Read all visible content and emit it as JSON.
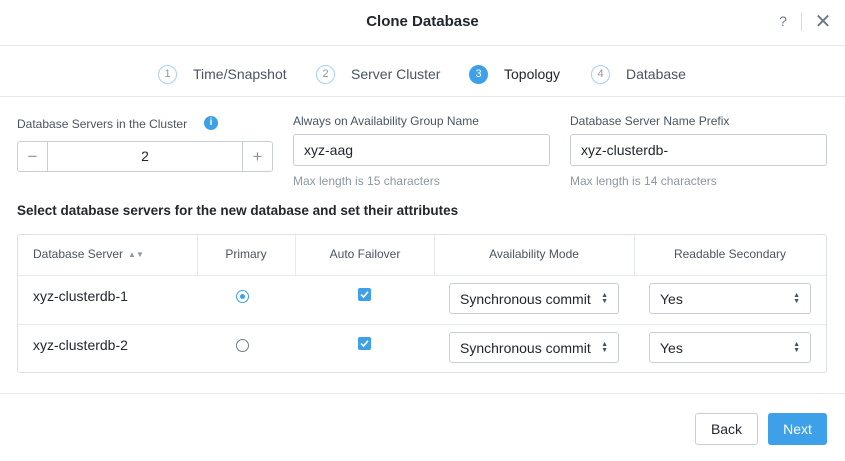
{
  "dialog": {
    "title": "Clone Database",
    "help_label": "?",
    "close_label": "✕"
  },
  "steps": [
    {
      "number": "1",
      "label": "Time/Snapshot",
      "active": false
    },
    {
      "number": "2",
      "label": "Server Cluster",
      "active": false
    },
    {
      "number": "3",
      "label": "Topology",
      "active": true
    },
    {
      "number": "4",
      "label": "Database",
      "active": false
    }
  ],
  "form": {
    "servers_count": {
      "label": "Database Servers in the Cluster",
      "info_icon": "i",
      "value": "2",
      "minus": "−",
      "plus": "+"
    },
    "ag_name": {
      "label": "Always on Availability Group Name",
      "value": "xyz-aag",
      "hint": "Max length is 15 characters"
    },
    "name_prefix": {
      "label": "Database Server Name Prefix",
      "value": "xyz-clusterdb-",
      "hint": "Max length is 14 characters"
    }
  },
  "section_title": "Select database servers for the new database and set their attributes",
  "table": {
    "columns": [
      "Database Server",
      "Primary",
      "Auto Failover",
      "Availability Mode",
      "Readable Secondary"
    ],
    "sort_icon": "▲▼",
    "rows": [
      {
        "server": "xyz-clusterdb-1",
        "primary": true,
        "auto_failover": true,
        "availability_mode": "Synchronous commit",
        "readable_secondary": "Yes"
      },
      {
        "server": "xyz-clusterdb-2",
        "primary": false,
        "auto_failover": true,
        "availability_mode": "Synchronous commit",
        "readable_secondary": "Yes"
      }
    ]
  },
  "footer": {
    "back_label": "Back",
    "next_label": "Next"
  },
  "colors": {
    "accent": "#3ea0e8",
    "border": "#c9ced4",
    "text": "#22272e",
    "muted": "#8c97a3"
  }
}
